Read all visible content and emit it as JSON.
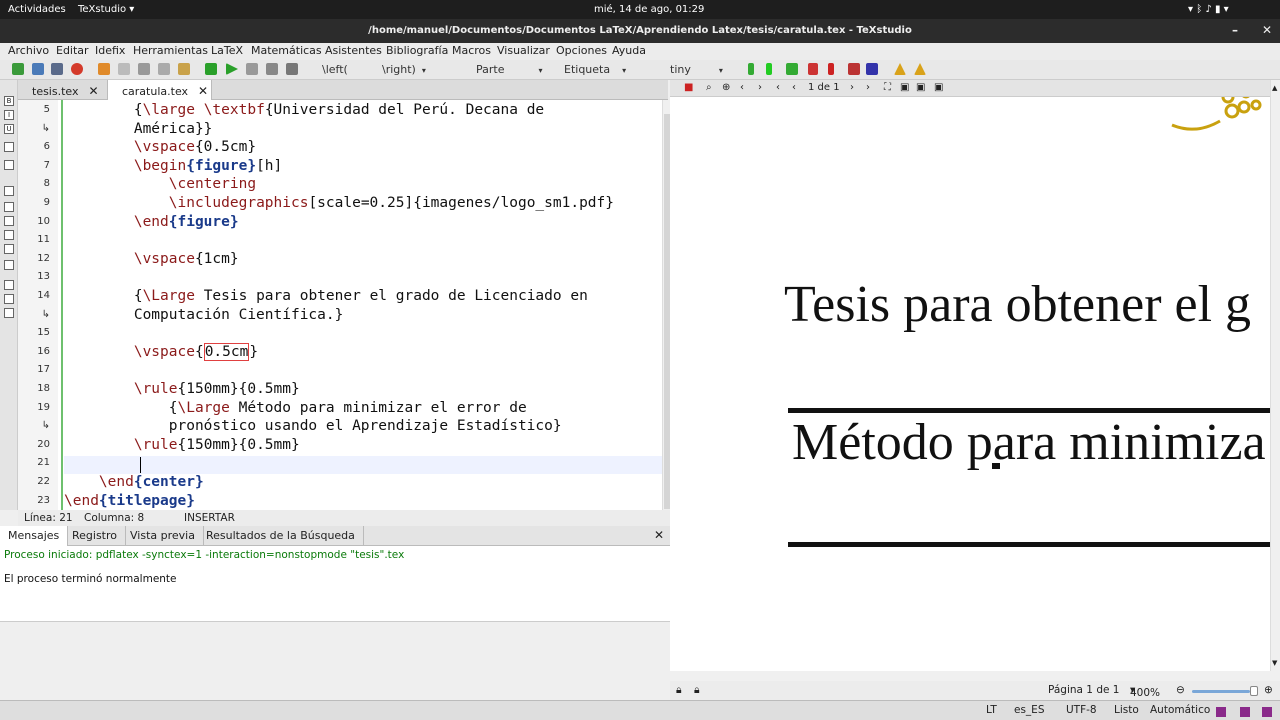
{
  "system_bar": {
    "activities": "Actividades",
    "app": "TeXstudio",
    "datetime": "mié, 14 de ago, 01:29"
  },
  "window_title": "/home/manuel/Documentos/Documentos LaTeX/Aprendiendo Latex/tesis/caratula.tex - TeXstudio",
  "menu": [
    "Archivo",
    "Editar",
    "Idefix",
    "Herramientas",
    "LaTeX",
    "Matemáticas",
    "Asistentes",
    "Bibliografía",
    "Macros",
    "Visualizar",
    "Opciones",
    "Ayuda"
  ],
  "toolbar": {
    "left_combo": "\\left(",
    "right_combo": "\\right)",
    "section_combo": "Parte",
    "label_combo": "Etiqueta",
    "size_combo": "tiny"
  },
  "tabs": [
    {
      "label": "tesis.tex"
    },
    {
      "label": "caratula.tex"
    }
  ],
  "editor": {
    "line_numbers": [
      "5",
      "↳",
      "6",
      "7",
      "8",
      "9",
      "10",
      "11",
      "12",
      "13",
      "14",
      "↳",
      "15",
      "16",
      "17",
      "18",
      "19",
      "↳",
      "20",
      "21",
      "22",
      "23"
    ],
    "lines": [
      "        {\\large \\textbf{Universidad del Perú. Decana de",
      "        América}}",
      "        \\vspace{0.5cm}",
      "        \\begin{figure}[h]",
      "            \\centering",
      "            \\includegraphics[scale=0.25]{imagenes/logo_sm1.pdf}",
      "        \\end{figure}",
      "",
      "        \\vspace{1cm}",
      "",
      "        {\\Large Tesis para obtener el grado de Licenciado en",
      "        Computación Científica.}",
      "",
      "        \\vspace{0.5cm}",
      "",
      "        \\rule{150mm}{0.5mm}",
      "            {\\Large Método para minimizar el error de",
      "            pronóstico usando el Aprendizaje Estadístico}",
      "        \\rule{150mm}{0.5mm}",
      "",
      "    \\end{center}",
      "\\end{titlepage}"
    ]
  },
  "status_line": {
    "line": "Línea: 21",
    "column": "Columna: 8",
    "mode": "INSERTAR"
  },
  "message_tabs": [
    "Mensajes",
    "Registro",
    "Vista previa",
    "Resultados de la Búsqueda"
  ],
  "messages": {
    "started": "Proceso iniciado: pdflatex -synctex=1 -interaction=nonstopmode \"tesis\".tex",
    "finished": "El proceso terminó normalmente"
  },
  "pdf_viewer": {
    "page_indicator": "1 de 1",
    "text_line_1": "Tesis para obtener el g",
    "text_line_2": "Método para minimiza",
    "page_status": "Página 1 de 1",
    "zoom": "400%",
    "zoom_slider_level": 0.93
  },
  "bottom_bar": {
    "lt": "LT",
    "language": "es_ES",
    "encoding": "UTF-8",
    "ready": "Listo",
    "mode": "Automático"
  },
  "colors": {
    "command": "#8b1a1a",
    "keyword": "#1a3a8a",
    "success": "#0a7a0a",
    "accent": "#6ec06e"
  }
}
